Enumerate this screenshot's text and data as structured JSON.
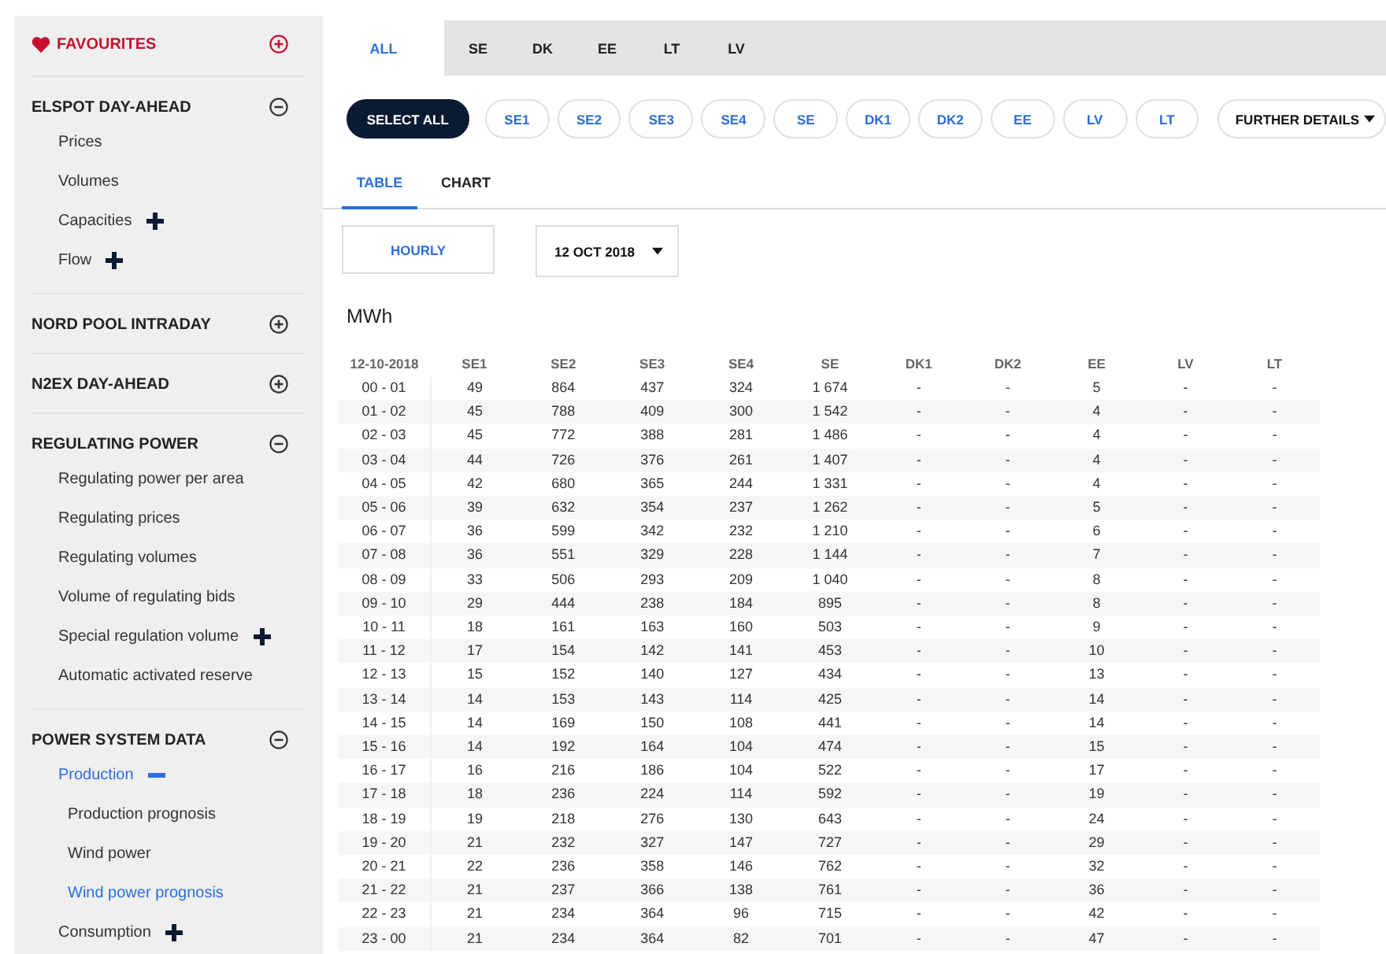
{
  "sidebar": {
    "sections": [
      {
        "kind": "favourites",
        "title": "FAVOURITES"
      },
      {
        "kind": "group",
        "title": "ELSPOT DAY-AHEAD",
        "expanded": true,
        "items": [
          {
            "label": "Prices",
            "selected": false
          },
          {
            "label": "Volumes",
            "selected": false
          },
          {
            "label": "Capacities",
            "selected": false,
            "expanded": false
          },
          {
            "label": "Flow",
            "selected": false,
            "expanded": false
          }
        ]
      },
      {
        "kind": "group",
        "title": "NORD POOL INTRADAY",
        "expanded": false
      },
      {
        "kind": "group",
        "title": "N2EX DAY-AHEAD",
        "expanded": false
      },
      {
        "kind": "group",
        "title": "REGULATING POWER",
        "expanded": true,
        "items": [
          {
            "label": "Regulating power per area",
            "selected": false
          },
          {
            "label": "Regulating prices",
            "selected": false
          },
          {
            "label": "Regulating volumes",
            "selected": false
          },
          {
            "label": "Volume of regulating bids",
            "selected": false
          },
          {
            "label": "Special regulation volume",
            "selected": false,
            "expanded": false
          },
          {
            "label": "Automatic activated reserve",
            "selected": false
          }
        ]
      },
      {
        "kind": "group",
        "title": "POWER SYSTEM DATA",
        "expanded": true,
        "items": [
          {
            "label": "Production",
            "selected": false,
            "expanded": true,
            "children": [
              {
                "label": "Production prognosis",
                "selected": false
              },
              {
                "label": "Wind power",
                "selected": false
              },
              {
                "label": "Wind power prognosis",
                "selected": true
              }
            ]
          },
          {
            "label": "Consumption",
            "selected": false,
            "expanded": false
          }
        ]
      }
    ]
  },
  "area_tabs": [
    {
      "label": "ALL",
      "selected": true
    },
    {
      "label": "SE",
      "selected": false
    },
    {
      "label": "DK",
      "selected": false
    },
    {
      "label": "EE",
      "selected": false
    },
    {
      "label": "LT",
      "selected": false
    },
    {
      "label": "LV",
      "selected": false
    }
  ],
  "area_filters": [
    {
      "label": "SELECT ALL",
      "selected": true
    },
    {
      "label": "SE1",
      "selected": false
    },
    {
      "label": "SE2",
      "selected": false
    },
    {
      "label": "SE3",
      "selected": false
    },
    {
      "label": "SE4",
      "selected": false
    },
    {
      "label": "SE",
      "selected": false
    },
    {
      "label": "DK1",
      "selected": false
    },
    {
      "label": "DK2",
      "selected": false
    },
    {
      "label": "EE",
      "selected": false
    },
    {
      "label": "LV",
      "selected": false
    },
    {
      "label": "LT",
      "selected": false
    }
  ],
  "further_details": {
    "label": "FURTHER DETAILS"
  },
  "view_tabs": [
    {
      "label": "TABLE",
      "selected": true
    },
    {
      "label": "CHART",
      "selected": false
    }
  ],
  "resolution_button": {
    "label": "HOURLY"
  },
  "date_dropdown": {
    "value": "12 OCT 2018"
  },
  "unit": "MWh",
  "table": {
    "columns": [
      "12-10-2018",
      "SE1",
      "SE2",
      "SE3",
      "SE4",
      "SE",
      "DK1",
      "DK2",
      "EE",
      "LV",
      "LT"
    ],
    "rows": [
      [
        "00 - 01",
        "49",
        "864",
        "437",
        "324",
        "1 674",
        "-",
        "-",
        "5",
        "-",
        "-"
      ],
      [
        "01 - 02",
        "45",
        "788",
        "409",
        "300",
        "1 542",
        "-",
        "-",
        "4",
        "-",
        "-"
      ],
      [
        "02 - 03",
        "45",
        "772",
        "388",
        "281",
        "1 486",
        "-",
        "-",
        "4",
        "-",
        "-"
      ],
      [
        "03 - 04",
        "44",
        "726",
        "376",
        "261",
        "1 407",
        "-",
        "-",
        "4",
        "-",
        "-"
      ],
      [
        "04 - 05",
        "42",
        "680",
        "365",
        "244",
        "1 331",
        "-",
        "-",
        "4",
        "-",
        "-"
      ],
      [
        "05 - 06",
        "39",
        "632",
        "354",
        "237",
        "1 262",
        "-",
        "-",
        "5",
        "-",
        "-"
      ],
      [
        "06 - 07",
        "36",
        "599",
        "342",
        "232",
        "1 210",
        "-",
        "-",
        "6",
        "-",
        "-"
      ],
      [
        "07 - 08",
        "36",
        "551",
        "329",
        "228",
        "1 144",
        "-",
        "-",
        "7",
        "-",
        "-"
      ],
      [
        "08 - 09",
        "33",
        "506",
        "293",
        "209",
        "1 040",
        "-",
        "-",
        "8",
        "-",
        "-"
      ],
      [
        "09 - 10",
        "29",
        "444",
        "238",
        "184",
        "895",
        "-",
        "-",
        "8",
        "-",
        "-"
      ],
      [
        "10 - 11",
        "18",
        "161",
        "163",
        "160",
        "503",
        "-",
        "-",
        "9",
        "-",
        "-"
      ],
      [
        "11 - 12",
        "17",
        "154",
        "142",
        "141",
        "453",
        "-",
        "-",
        "10",
        "-",
        "-"
      ],
      [
        "12 - 13",
        "15",
        "152",
        "140",
        "127",
        "434",
        "-",
        "-",
        "13",
        "-",
        "-"
      ],
      [
        "13 - 14",
        "14",
        "153",
        "143",
        "114",
        "425",
        "-",
        "-",
        "14",
        "-",
        "-"
      ],
      [
        "14 - 15",
        "14",
        "169",
        "150",
        "108",
        "441",
        "-",
        "-",
        "14",
        "-",
        "-"
      ],
      [
        "15 - 16",
        "14",
        "192",
        "164",
        "104",
        "474",
        "-",
        "-",
        "15",
        "-",
        "-"
      ],
      [
        "16 - 17",
        "16",
        "216",
        "186",
        "104",
        "522",
        "-",
        "-",
        "17",
        "-",
        "-"
      ],
      [
        "17 - 18",
        "18",
        "236",
        "224",
        "114",
        "592",
        "-",
        "-",
        "19",
        "-",
        "-"
      ],
      [
        "18 - 19",
        "19",
        "218",
        "276",
        "130",
        "643",
        "-",
        "-",
        "24",
        "-",
        "-"
      ],
      [
        "19 - 20",
        "21",
        "232",
        "327",
        "147",
        "727",
        "-",
        "-",
        "29",
        "-",
        "-"
      ],
      [
        "20 - 21",
        "22",
        "236",
        "358",
        "146",
        "762",
        "-",
        "-",
        "32",
        "-",
        "-"
      ],
      [
        "21 - 22",
        "21",
        "237",
        "366",
        "138",
        "761",
        "-",
        "-",
        "36",
        "-",
        "-"
      ],
      [
        "22 - 23",
        "21",
        "234",
        "364",
        "96",
        "715",
        "-",
        "-",
        "42",
        "-",
        "-"
      ],
      [
        "23 - 00",
        "21",
        "234",
        "364",
        "82",
        "701",
        "-",
        "-",
        "47",
        "-",
        "-"
      ]
    ]
  }
}
